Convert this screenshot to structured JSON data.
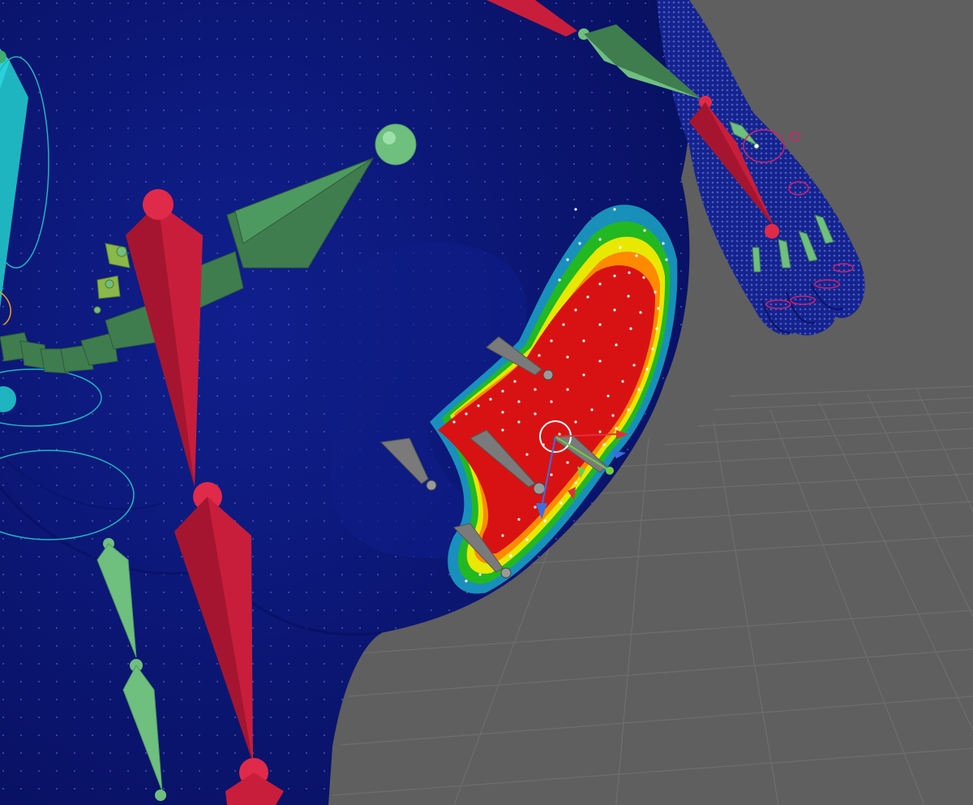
{
  "viewport": {
    "panel": "3d-viewport",
    "shading": "weight-paint",
    "colors": {
      "background": "#5f5f5f",
      "grid": "#6e6e6e",
      "mesh": "#0c1a82",
      "mesh_shadow": "#071060",
      "weight_high": "#d81212",
      "weight_mid_high": "#ff8a00",
      "weight_mid": "#e8e800",
      "weight_low": "#22b822",
      "weight_lowest": "#1ba6c8",
      "bone_red": "#c81e3c",
      "bone_green": "#3f7d4f",
      "bone_light_green": "#6fbf7f",
      "bone_cyan": "#1fb5c0",
      "bone_gray": "#7a7a7a",
      "gizmo_x": "#e0303a",
      "gizmo_y": "#6fcf3f",
      "gizmo_z": "#3a6fe0",
      "control_ring": "#d0206a"
    },
    "icons": [
      "bone-icon",
      "joint-icon",
      "transform-gizmo-icon",
      "rotation-ring-icon",
      "ik-control-icon"
    ]
  }
}
